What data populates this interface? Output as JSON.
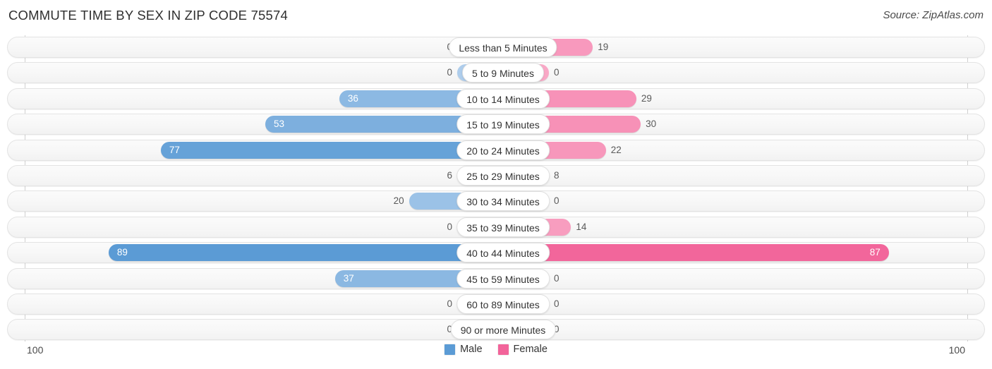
{
  "header": {
    "title": "COMMUTE TIME BY SEX IN ZIP CODE 75574",
    "source": "Source: ZipAtlas.com"
  },
  "footer": {
    "axis_min_label": "100",
    "axis_max_label": "100",
    "legend": [
      {
        "label": "Male",
        "color": "#5b9bd5"
      },
      {
        "label": "Female",
        "color": "#f2649a"
      }
    ]
  },
  "colors": {
    "male": "#5b9bd5",
    "female": "#f2649a",
    "male_light": "#aecdec",
    "female_light": "#f9a8c6",
    "track": "#f7f7f7",
    "track_border": "#e3e3e3"
  },
  "chart_data": {
    "type": "bar",
    "orientation": "horizontal",
    "layout": "diverging-bidirectional",
    "title": "COMMUTE TIME BY SEX IN ZIP CODE 75574",
    "xlabel": "",
    "ylabel": "",
    "xlim": [
      100,
      100
    ],
    "grid": false,
    "legend_position": "bottom-center",
    "categories": [
      "Less than 5 Minutes",
      "5 to 9 Minutes",
      "10 to 14 Minutes",
      "15 to 19 Minutes",
      "20 to 24 Minutes",
      "25 to 29 Minutes",
      "30 to 34 Minutes",
      "35 to 39 Minutes",
      "40 to 44 Minutes",
      "45 to 59 Minutes",
      "60 to 89 Minutes",
      "90 or more Minutes"
    ],
    "series": [
      {
        "name": "Male",
        "direction": "left",
        "values": [
          0,
          0,
          36,
          53,
          77,
          6,
          20,
          0,
          89,
          37,
          0,
          0
        ]
      },
      {
        "name": "Female",
        "direction": "right",
        "values": [
          19,
          0,
          29,
          30,
          22,
          8,
          0,
          14,
          87,
          0,
          0,
          0
        ]
      }
    ]
  }
}
